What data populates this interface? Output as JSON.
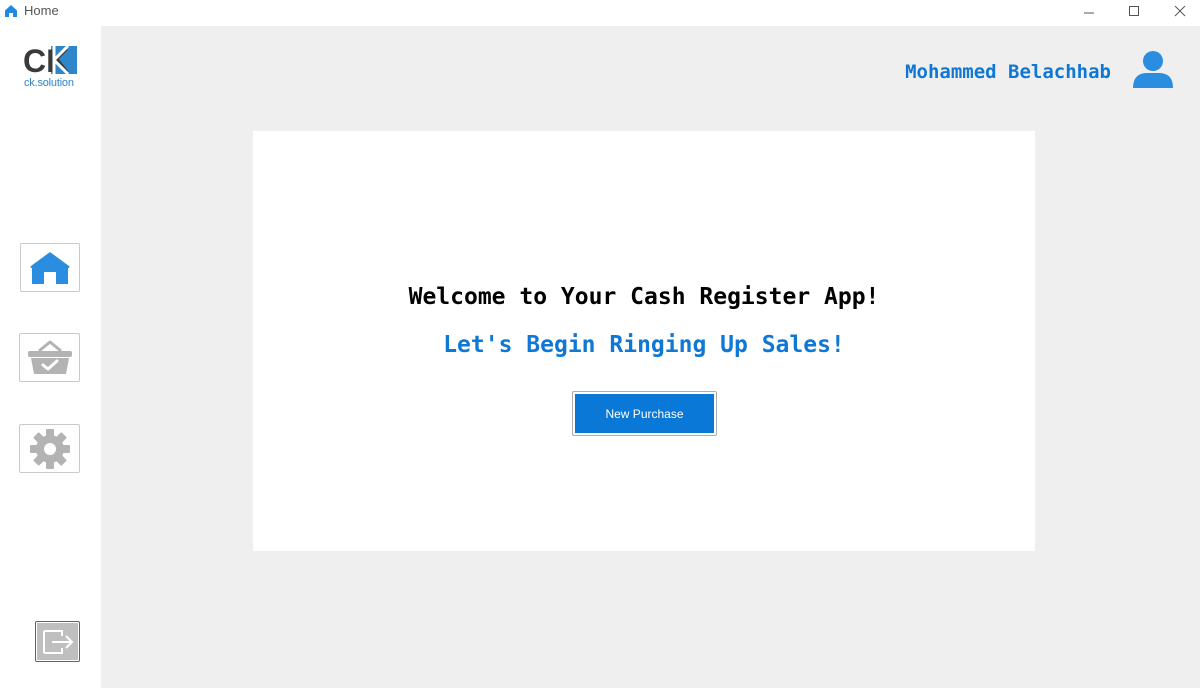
{
  "window": {
    "title": "Home",
    "controls": [
      "minimize",
      "maximize",
      "close"
    ]
  },
  "sidebar": {
    "logo": {
      "mark": "CK",
      "text": "ck.solution"
    },
    "items": [
      {
        "name": "home",
        "icon": "home-icon"
      },
      {
        "name": "purchases",
        "icon": "basket-check-icon"
      },
      {
        "name": "settings",
        "icon": "gear-icon"
      }
    ],
    "logout_icon": "logout-arrow-icon"
  },
  "header": {
    "username": "Mohammed Belachhab",
    "user_icon": "user-icon"
  },
  "main": {
    "welcome": "Welcome to Your Cash Register App!",
    "subtitle": "Let's Begin Ringing Up Sales!",
    "new_purchase_label": "New Purchase"
  },
  "colors": {
    "accent": "#0a78d7",
    "text_blue": "#0e78d4",
    "background": "#efefef",
    "icon_gray": "#b3b3b3",
    "icon_blue": "#2b8de0"
  }
}
